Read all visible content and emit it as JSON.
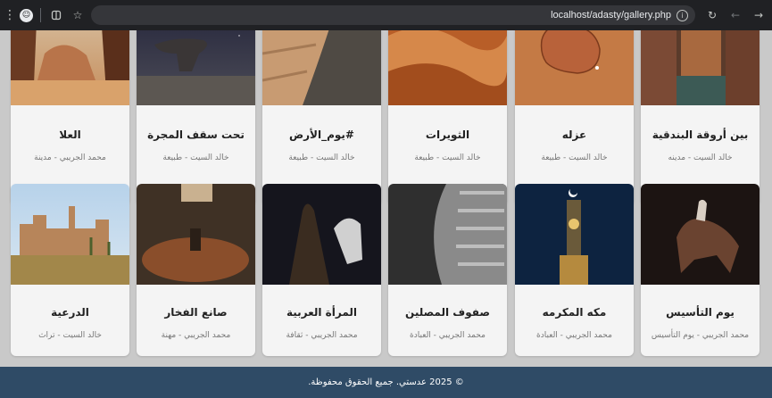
{
  "browser": {
    "menu_icon": "kebab-menu-icon",
    "url": "localhost/adasty/gallery.php"
  },
  "gallery": {
    "row1": [
      {
        "title": "العلا",
        "meta": "محمد الجريبي - مدينة",
        "icon": "photo-desert-rocks"
      },
      {
        "title": "تحت سقف المجرة",
        "meta": "خالد السيت - طبيعة",
        "icon": "photo-night-sky-rock"
      },
      {
        "title": "#يوم_الأرض",
        "meta": "خالد السيت - طبيعة",
        "icon": "photo-aerial-coast"
      },
      {
        "title": "الثويرات",
        "meta": "خالد السيت - طبيعة",
        "icon": "photo-sand-dunes"
      },
      {
        "title": "عزله",
        "meta": "خالد السيت - طبيعة",
        "icon": "photo-desert-island"
      },
      {
        "title": "بين أروقة البندقية",
        "meta": "خالد السيت - مدينه",
        "icon": "photo-venice-canal"
      }
    ],
    "row2": [
      {
        "title": "الدرعية",
        "meta": "خالد السيت - تراث",
        "icon": "photo-mud-fort"
      },
      {
        "title": "صانع الفخار",
        "meta": "محمد الجريبي - مهنة",
        "icon": "photo-pottery-maker"
      },
      {
        "title": "المرأة العربية",
        "meta": "محمد الجريبي - ثقافة",
        "icon": "photo-woman-horse-night"
      },
      {
        "title": "صفوف المصلين",
        "meta": "محمد الجريبي - العبادة",
        "icon": "photo-worshippers-aerial"
      },
      {
        "title": "مكه المكرمه",
        "meta": "محمد الجريبي - العبادة",
        "icon": "photo-clock-tower-moon"
      },
      {
        "title": "يوم التأسيس",
        "meta": "محمد الجريبي - يوم التأسيس",
        "icon": "photo-horse-rider"
      }
    ]
  },
  "footer": {
    "text": "© 2025 عدستي. جميع الحقوق محفوظة."
  }
}
